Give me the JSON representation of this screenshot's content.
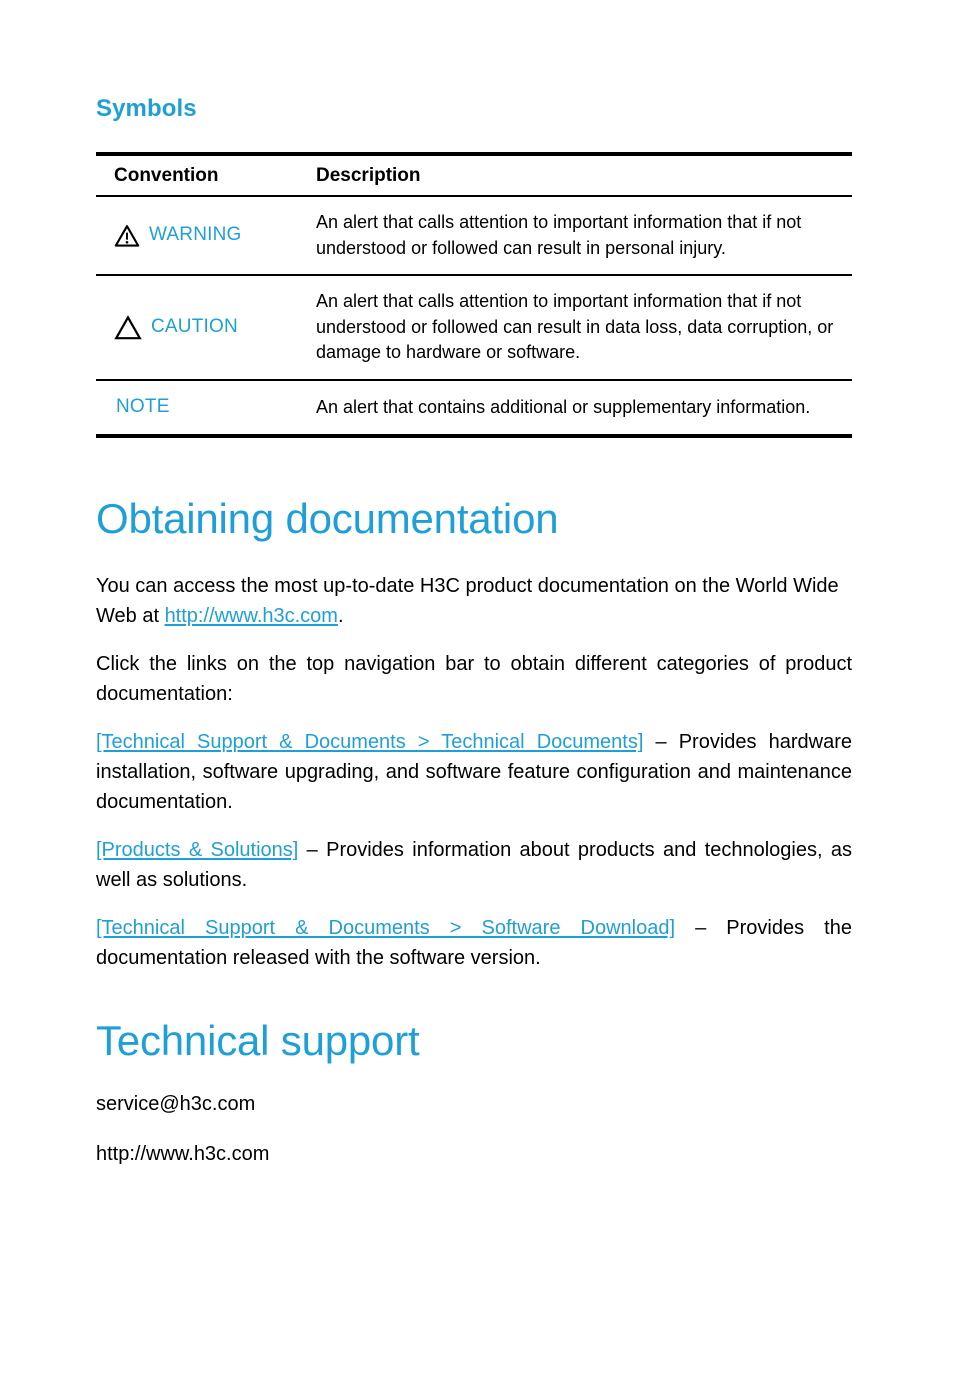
{
  "section_symbols": {
    "heading": "Symbols",
    "table": {
      "headers": [
        "Convention",
        "Description"
      ],
      "rows": [
        {
          "icon": "warning-triangle-exclamation-icon",
          "label": "WARNING",
          "description": "An alert that calls attention to important information that if not understood or followed can result in personal injury."
        },
        {
          "icon": "caution-triangle-icon",
          "label": "CAUTION",
          "description": "An alert that calls attention to important information that if not understood or followed can result in data loss, data corruption, or damage to hardware or software."
        },
        {
          "icon": "none",
          "label": "NOTE",
          "description": "An alert that contains additional or supplementary information."
        }
      ]
    }
  },
  "section_obtaining": {
    "heading": "Obtaining documentation",
    "paragraph_1": {
      "before": "You can access the most up-to-date H3C product documentation on the World Wide Web at ",
      "link": "http://www.h3c.com",
      "after": "."
    },
    "paragraph_2": "Click the links on the top navigation bar to obtain different categories of product documentation:",
    "link_items": [
      {
        "link": "[Technical Support & Documents > Technical Documents]",
        "text": " – Provides hardware installation, software upgrading, and software feature configuration and maintenance documentation."
      },
      {
        "link": "[Products & Solutions]",
        "text": " – Provides information about products and technologies, as well as solutions."
      },
      {
        "link": "[Technical Support & Documents > Software Download]",
        "text": " – Provides the documentation released with the software version."
      }
    ]
  },
  "section_support": {
    "heading": "Technical support",
    "email": "service@h3c.com",
    "website": "http://www.h3c.com"
  },
  "colors": {
    "accent_blue": "#1f9fd8",
    "text_black": "#000000",
    "background": "#ffffff"
  }
}
